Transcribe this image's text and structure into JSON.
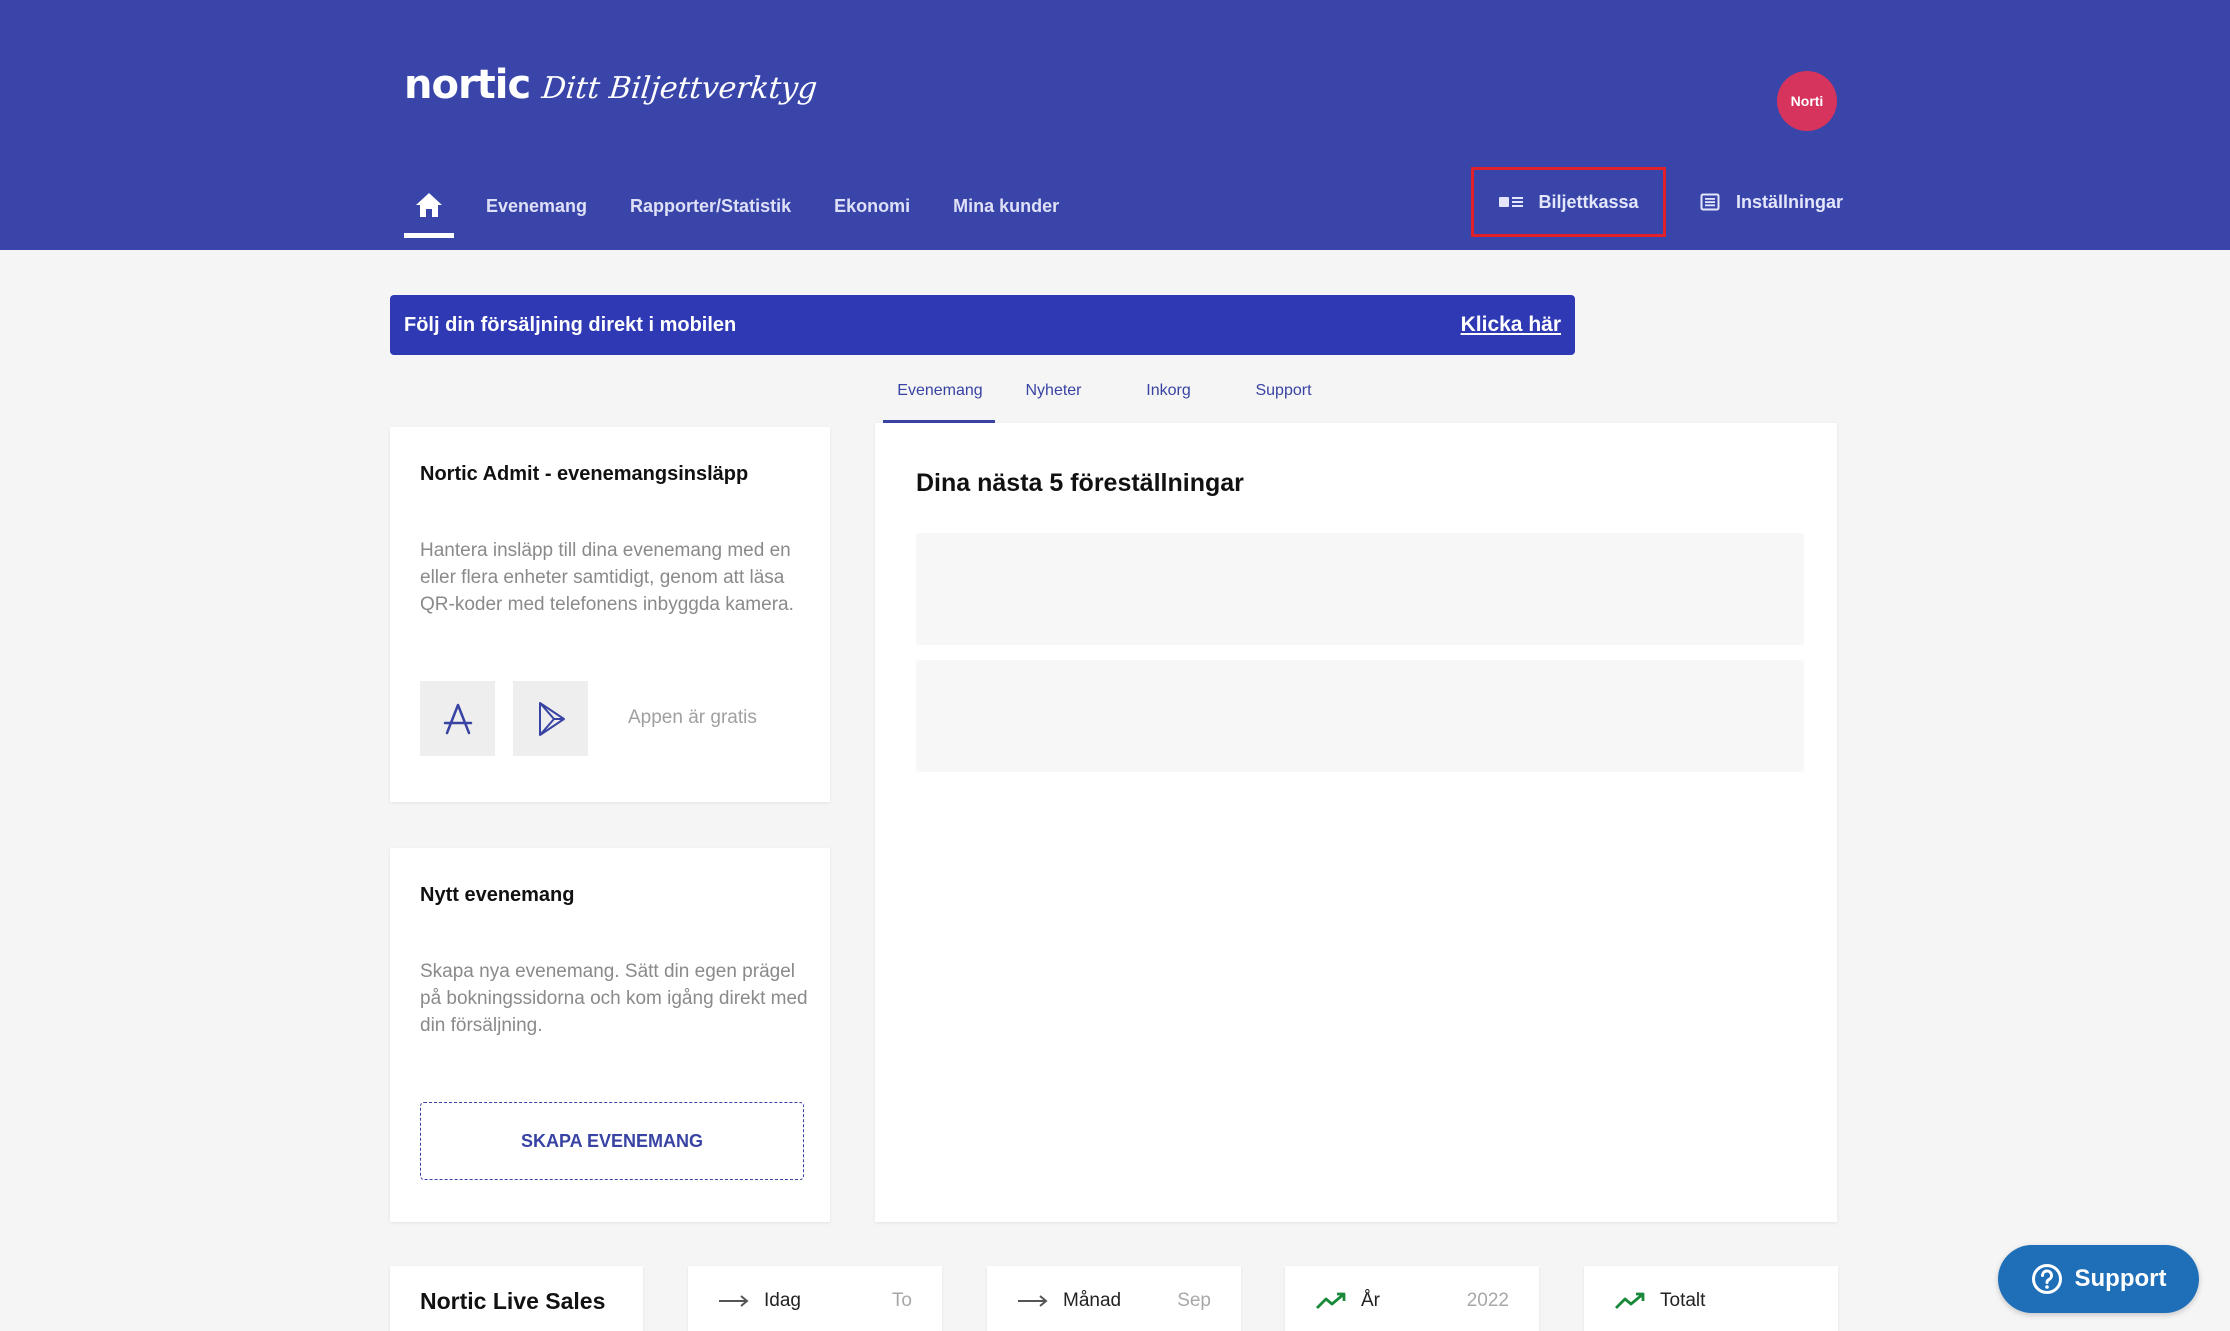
{
  "brand": {
    "name": "nortic",
    "tagline": "Ditt Biljettverktyg"
  },
  "user": {
    "avatar_text": "Norti"
  },
  "nav": {
    "home_icon": "home-icon",
    "items": [
      {
        "label": "Evenemang"
      },
      {
        "label": "Rapporter/Statistik"
      },
      {
        "label": "Ekonomi"
      },
      {
        "label": "Mina kunder"
      }
    ],
    "biljettkassa": "Biljettkassa",
    "installningar": "Inställningar"
  },
  "banner": {
    "text": "Följ din försäljning direkt i mobilen",
    "link": "Klicka här"
  },
  "tabs": [
    {
      "label": "Evenemang",
      "active": true
    },
    {
      "label": "Nyheter"
    },
    {
      "label": "Inkorg"
    },
    {
      "label": "Support"
    }
  ],
  "admit_card": {
    "title": "Nortic Admit - evenemangsinsläpp",
    "description": "Hantera insläpp till dina evenemang med en eller flera enheter samtidigt, genom att läsa QR-koder med telefonens inbyggda kamera.",
    "app_free": "Appen är gratis",
    "icons": [
      "app-store-icon",
      "google-play-icon"
    ]
  },
  "new_event_card": {
    "title": "Nytt evenemang",
    "description": "Skapa nya evenemang. Sätt din egen prägel på bokningssidorna och kom igång direkt med din försäljning.",
    "button": "SKAPA EVENEMANG"
  },
  "shows_card": {
    "title": "Dina nästa 5 föreställningar"
  },
  "live_sales": {
    "title": "Nortic Live Sales",
    "stats": [
      {
        "label": "Idag",
        "value": "To",
        "trend": "flat"
      },
      {
        "label": "Månad",
        "value": "Sep",
        "trend": "flat"
      },
      {
        "label": "År",
        "value": "2022",
        "trend": "up"
      },
      {
        "label": "Totalt",
        "value": "",
        "trend": "up"
      }
    ]
  },
  "support_fab": {
    "label": "Support"
  },
  "colors": {
    "header": "#3945a9",
    "banner": "#2f39b3",
    "accent": "#3843a3",
    "avatar": "#d6335d",
    "highlight": "#e0202a",
    "support": "#1e6eb8",
    "trend_up": "#1a8a3a"
  }
}
